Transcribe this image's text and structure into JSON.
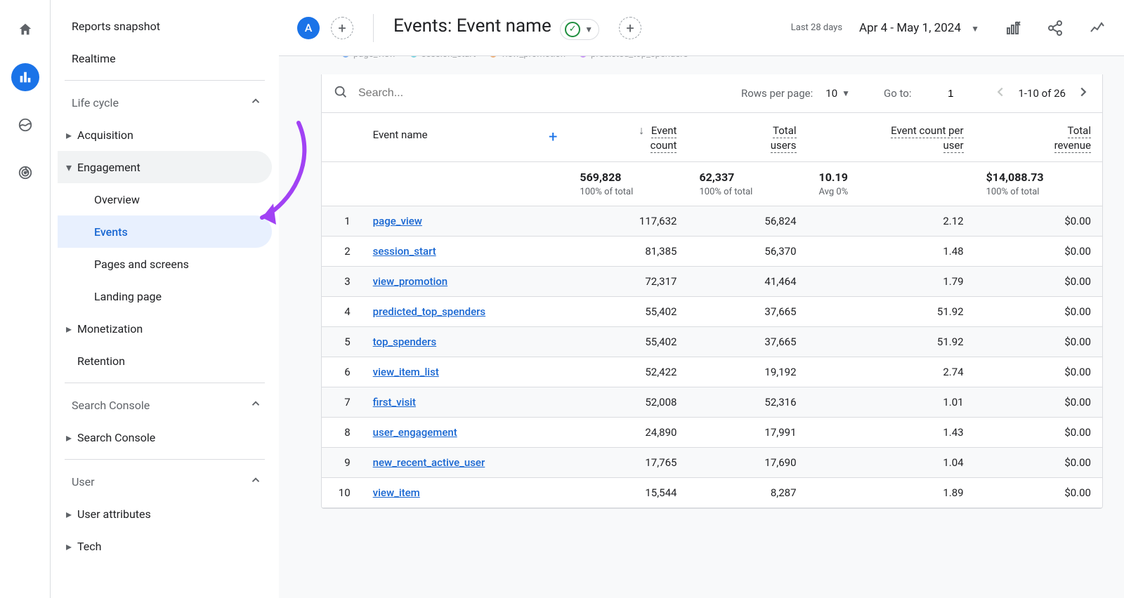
{
  "rail": {
    "items": [
      "home",
      "reports",
      "explore",
      "advertising"
    ]
  },
  "nav": {
    "reports_snapshot": "Reports snapshot",
    "realtime": "Realtime",
    "sections": {
      "lifecycle": {
        "label": "Life cycle",
        "groups": {
          "acquisition": "Acquisition",
          "engagement": {
            "label": "Engagement",
            "items": {
              "overview": "Overview",
              "events": "Events",
              "pages": "Pages and screens",
              "landing": "Landing page"
            }
          },
          "monetization": "Monetization",
          "retention": "Retention"
        }
      },
      "search_console": {
        "label": "Search Console",
        "groups": {
          "search_console": "Search Console"
        }
      },
      "user": {
        "label": "User",
        "groups": {
          "user_attributes": "User attributes",
          "tech": "Tech"
        }
      }
    }
  },
  "header": {
    "segment_letter": "A",
    "title": "Events: Event name",
    "date_label": "Last 28 days",
    "date_range": "Apr 4 - May 1, 2024"
  },
  "legend": [
    {
      "label": "page_view",
      "color": "#1a73e8"
    },
    {
      "label": "session_start",
      "color": "#12b5cb"
    },
    {
      "label": "view_promotion",
      "color": "#e8710a"
    },
    {
      "label": "predicted_top_spenders",
      "color": "#a142f4"
    }
  ],
  "table": {
    "search_placeholder": "Search...",
    "rows_per_page_label": "Rows per page:",
    "rows_per_page": "10",
    "goto_label": "Go to:",
    "goto_value": "1",
    "page_range": "1-10 of 26",
    "dimension": "Event name",
    "metrics": [
      {
        "name": "Event count",
        "total": "569,828",
        "sub": "100% of total"
      },
      {
        "name": "Total users",
        "total": "62,337",
        "sub": "100% of total"
      },
      {
        "name": "Event count per user",
        "total": "10.19",
        "sub": "Avg 0%"
      },
      {
        "name": "Total revenue",
        "total": "$14,088.73",
        "sub": "100% of total"
      }
    ],
    "rows": [
      {
        "n": "1",
        "name": "page_view",
        "v": [
          "117,632",
          "56,824",
          "2.12",
          "$0.00"
        ]
      },
      {
        "n": "2",
        "name": "session_start",
        "v": [
          "81,385",
          "56,370",
          "1.48",
          "$0.00"
        ]
      },
      {
        "n": "3",
        "name": "view_promotion",
        "v": [
          "72,317",
          "41,464",
          "1.79",
          "$0.00"
        ]
      },
      {
        "n": "4",
        "name": "predicted_top_spenders",
        "v": [
          "55,402",
          "37,665",
          "51.92",
          "$0.00"
        ]
      },
      {
        "n": "5",
        "name": "top_spenders",
        "v": [
          "55,402",
          "37,665",
          "51.92",
          "$0.00"
        ]
      },
      {
        "n": "6",
        "name": "view_item_list",
        "v": [
          "52,422",
          "19,192",
          "2.74",
          "$0.00"
        ]
      },
      {
        "n": "7",
        "name": "first_visit",
        "v": [
          "52,008",
          "52,316",
          "1.01",
          "$0.00"
        ]
      },
      {
        "n": "8",
        "name": "user_engagement",
        "v": [
          "24,890",
          "17,991",
          "1.43",
          "$0.00"
        ]
      },
      {
        "n": "9",
        "name": "new_recent_active_user",
        "v": [
          "17,765",
          "17,690",
          "1.04",
          "$0.00"
        ]
      },
      {
        "n": "10",
        "name": "view_item",
        "v": [
          "15,544",
          "8,287",
          "1.89",
          "$0.00"
        ]
      }
    ]
  }
}
